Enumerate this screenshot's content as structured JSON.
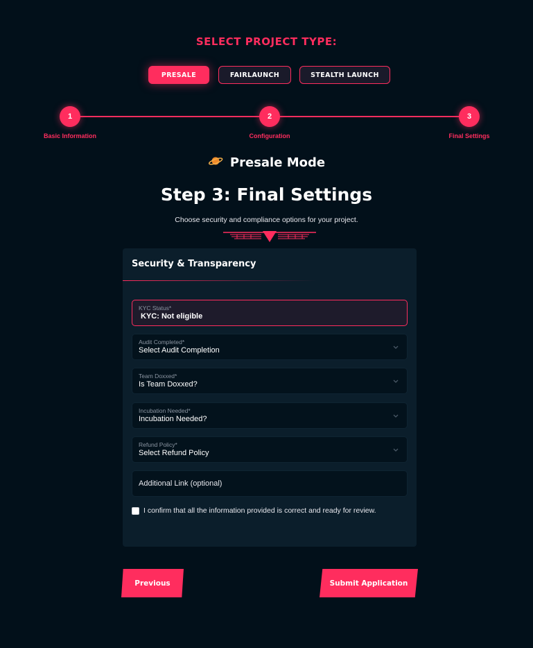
{
  "project_type": {
    "title": "SELECT PROJECT TYPE:",
    "options": [
      {
        "label": "PRESALE",
        "active": true
      },
      {
        "label": "FAIRLAUNCH",
        "active": false
      },
      {
        "label": "STEALTH LAUNCH",
        "active": false
      }
    ]
  },
  "steps": [
    {
      "number": "1",
      "label": "Basic Information"
    },
    {
      "number": "2",
      "label": "Configuration"
    },
    {
      "number": "3",
      "label": "Final Settings"
    }
  ],
  "mode": {
    "icon": "planet-icon",
    "label": "Presale Mode"
  },
  "heading": "Step 3: Final Settings",
  "subheading": "Choose security and compliance options for your project.",
  "card": {
    "title": "Security & Transparency",
    "kyc": {
      "label": "KYC Status*",
      "value": "KYC: Not eligible"
    },
    "audit": {
      "label": "Audit Completed*",
      "value": "Select Audit Completion"
    },
    "team": {
      "label": "Team Doxxed*",
      "value": "Is Team Doxxed?"
    },
    "incubation": {
      "label": "Incubation Needed*",
      "value": "Incubation Needed?"
    },
    "refund": {
      "label": "Refund Policy*",
      "value": "Select Refund Policy"
    },
    "link": {
      "placeholder": "Additional Link (optional)"
    },
    "confirm": "I confirm that all the information provided is correct and ready for review."
  },
  "buttons": {
    "previous": "Previous",
    "submit": "Submit Application"
  },
  "colors": {
    "accent": "#ff2d5e",
    "background": "#02101a",
    "card": "#0b1e2b"
  }
}
